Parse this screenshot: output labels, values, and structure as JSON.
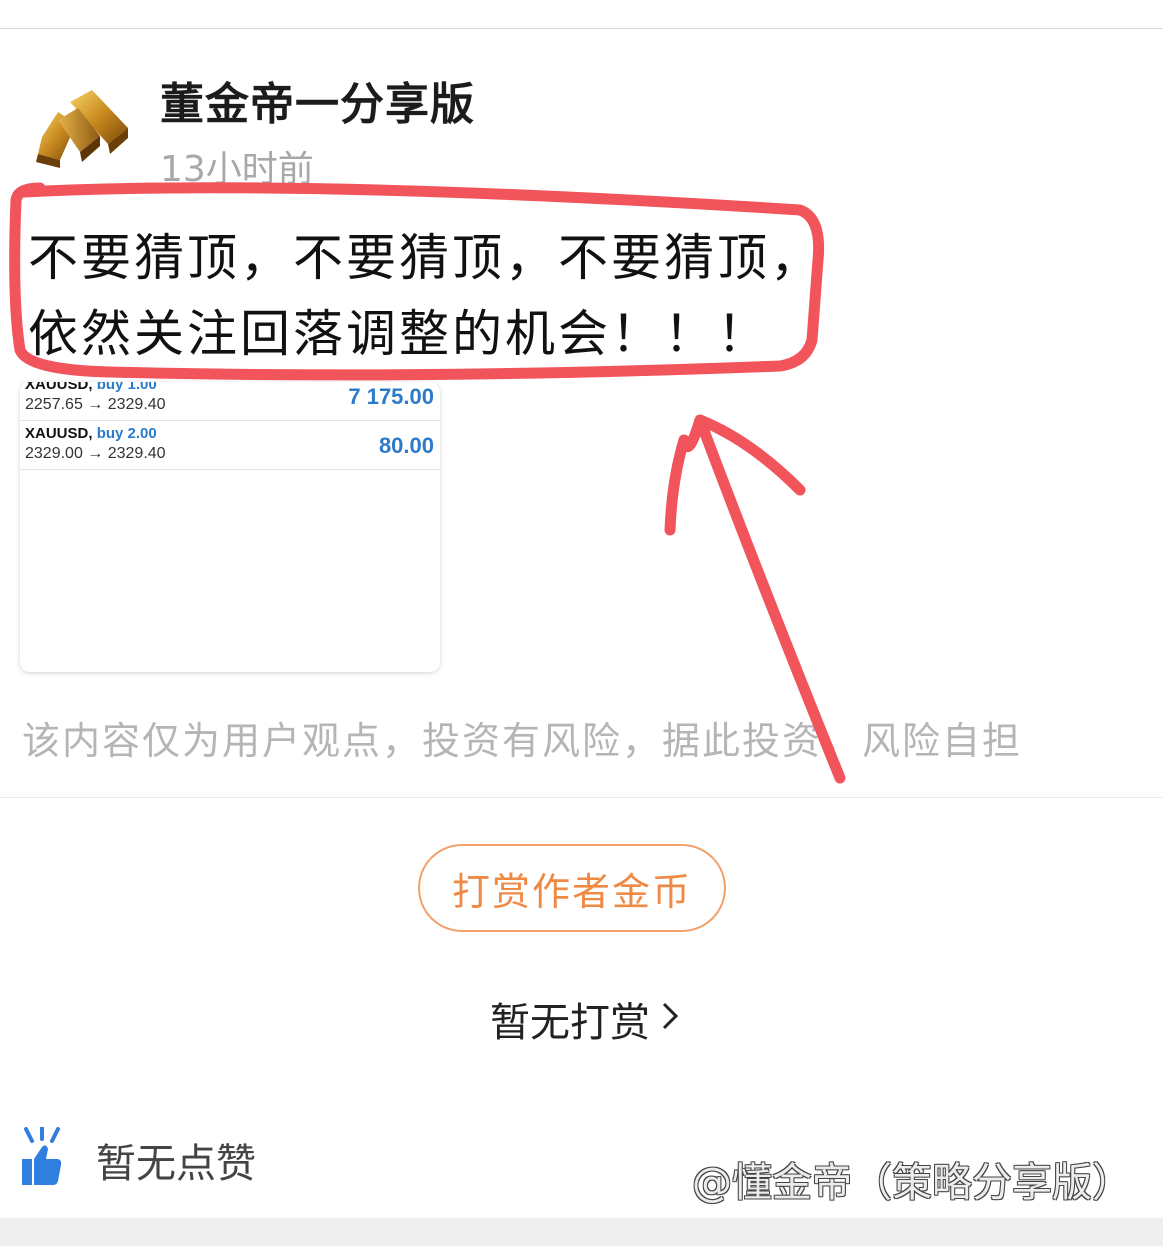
{
  "post": {
    "author": "董金帝一分享版",
    "time": "13小时前",
    "text_line1": "不要猜顶，不要猜顶，不要猜顶，",
    "text_line2": "依然关注回落调整的机会！！！"
  },
  "trades": [
    {
      "symbol": "XAUUSD,",
      "side": "buy 1.00",
      "prices": "2257.65 → 2329.40",
      "profit": "7 175.00"
    },
    {
      "symbol": "XAUUSD,",
      "side": "buy 2.00",
      "prices": "2329.00 → 2329.40",
      "profit": "80.00"
    }
  ],
  "disclaimer": "该内容仅为用户观点，投资有风险，据此投资，风险自担",
  "reward": {
    "button_label": "打赏作者金币",
    "status": "暂无打赏",
    "chevron": "›"
  },
  "likes": {
    "label": "暂无点赞",
    "icon": "thumbs-up-icon"
  },
  "watermark": "@懂金帝（策略分享版）",
  "colors": {
    "accent_orange": "#ef8a45",
    "trade_blue": "#2b7bc8",
    "annotation_red": "#f2545b",
    "like_blue": "#2f7fe0"
  }
}
